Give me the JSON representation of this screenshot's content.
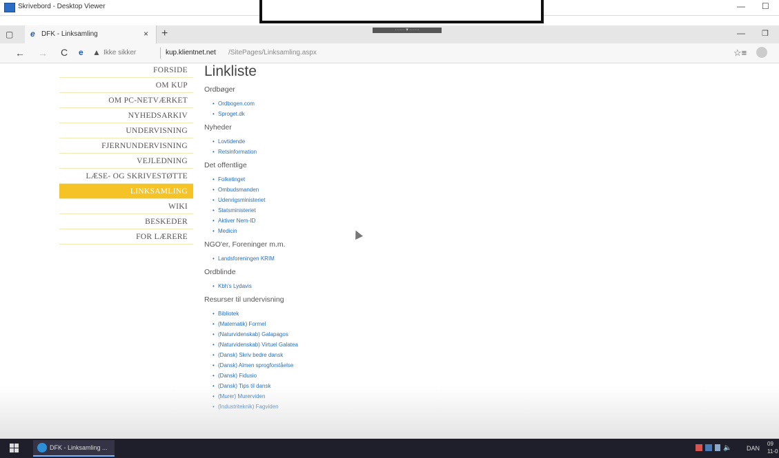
{
  "viewer": {
    "title": "Skrivebord - Desktop Viewer",
    "minimize": "—",
    "maximize": "☐"
  },
  "browser": {
    "tab_label": "DFK - Linksamling",
    "tab_close": "×",
    "new_tab": "+",
    "tab_center_text": "······ ▾ ······",
    "minimize": "—",
    "restore": "❐",
    "not_secure": "Ikke sikker",
    "url_domain": "kup.klientnet.net",
    "url_path": "/SitePages/Linksamling.aspx"
  },
  "icons": {
    "tab_actions": "▢",
    "tab_site": "e",
    "back": "←",
    "forward": "→",
    "refresh": "C",
    "edge": "e",
    "warning": "▲",
    "favorites": "☆≡"
  },
  "nav": {
    "items": [
      {
        "label": "FORSIDE",
        "active": false
      },
      {
        "label": "OM KUP",
        "active": false
      },
      {
        "label": "OM PC-NETVÆRKET",
        "active": false
      },
      {
        "label": "NYHEDSARKIV",
        "active": false
      },
      {
        "label": "UNDERVISNING",
        "active": false
      },
      {
        "label": "FJERNUNDERVISNING",
        "active": false
      },
      {
        "label": "VEJLEDNING",
        "active": false
      },
      {
        "label": "LÆSE- OG SKRIVESTØTTE",
        "active": false
      },
      {
        "label": "LINKSAMLING",
        "active": true
      },
      {
        "label": "WIKI",
        "active": false
      },
      {
        "label": "BESKEDER",
        "active": false
      },
      {
        "label": "FOR LÆRERE",
        "active": false
      }
    ]
  },
  "content": {
    "title": "Linkliste",
    "sections": [
      {
        "heading": "Ordbøger",
        "links": [
          "Ordbogen.com",
          "Sproget.dk"
        ]
      },
      {
        "heading": "Nyheder",
        "links": [
          "Lovtidende",
          "Retsinformation"
        ]
      },
      {
        "heading": "Det offentlige",
        "links": [
          "Folketinget",
          "Ombudsmanden",
          "Udenrigsministeriet",
          "Statsministeriet",
          "Aktiver Nem-ID",
          "Medicin"
        ]
      },
      {
        "heading": "NGO'er, Foreninger m.m.",
        "links": [
          "Landsforeningen KRIM"
        ]
      },
      {
        "heading": "Ordblinde",
        "links": [
          "Kbh's Lydavis"
        ]
      },
      {
        "heading": "Resurser til undervisning",
        "links": [
          "Bibliotek",
          "(Matematik) Formel",
          "(Naturvidenskab) Galapagos",
          "(Naturvidenskab) Virtuel Galatea",
          "(Dansk) Skriv bedre dansk",
          "(Dansk) Almen sprogforståelse",
          "(Dansk) Fidusio",
          "(Dansk) Tips til dansk",
          "(Murer) Murerviden",
          "(Industriteknik) Fagviden"
        ]
      }
    ]
  },
  "taskbar": {
    "app_label": "DFK - Linksamling ...",
    "language": "DAN",
    "clock_top": "09",
    "clock_bottom": "11-0"
  },
  "colors": {
    "active_nav": "#f5c326",
    "link": "#2a6fb6",
    "taskbar": "#1f1f2b"
  }
}
